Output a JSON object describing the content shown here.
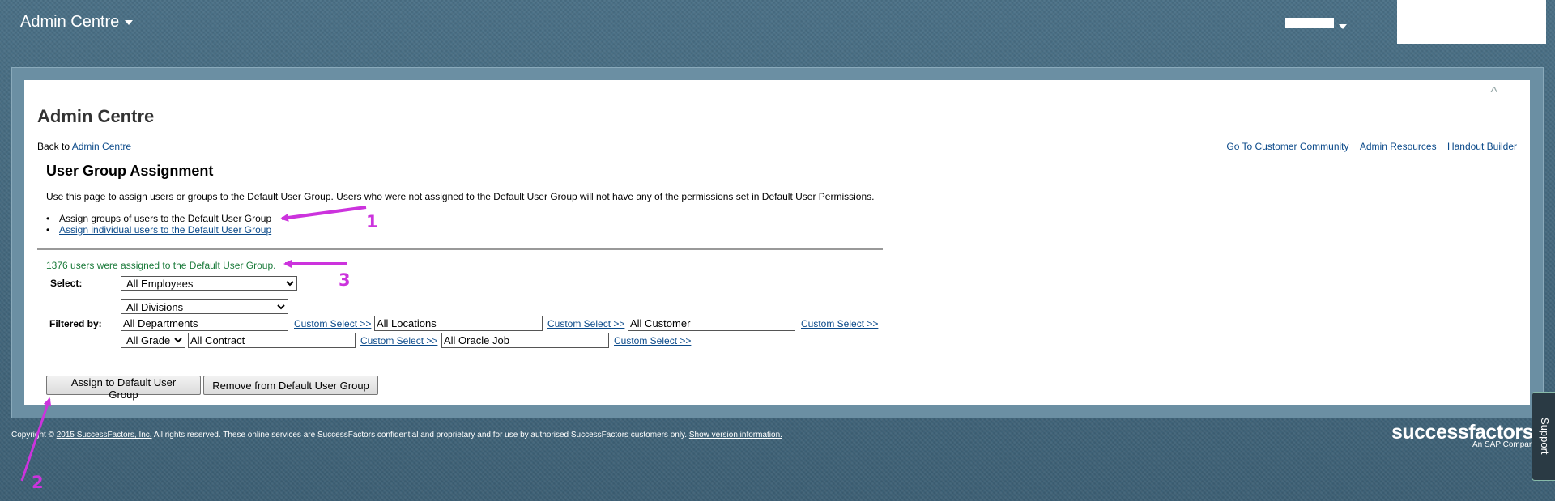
{
  "header": {
    "app_title": "Admin Centre"
  },
  "page": {
    "title": "Admin Centre",
    "back_prefix": "Back to",
    "back_link": "Admin Centre",
    "top_links": [
      "Go To Customer Community",
      "Admin Resources",
      "Handout Builder"
    ]
  },
  "section": {
    "title": "User Group Assignment",
    "description": "Use this page to assign users or groups to the Default User Group. Users who were not assigned to the Default User Group will not have any of the permissions set in Default User Permissions.",
    "bullet_groups": "Assign groups of users to the Default User Group",
    "bullet_individual": "Assign individual users to the Default User Group",
    "success_message": "1376 users were assigned to the Default User Group."
  },
  "filters": {
    "select_label": "Select:",
    "select_value": "All Employees",
    "filtered_by_label": "Filtered by:",
    "divisions": "All Divisions",
    "departments": "All Departments",
    "locations": "All Locations",
    "customer": "All Customer",
    "grade": "All Grade",
    "contract": "All Contract",
    "oracle_job": "All Oracle Job",
    "custom_select": "Custom Select >>"
  },
  "buttons": {
    "assign": "Assign to Default User Group",
    "remove": "Remove from Default User Group"
  },
  "footer": {
    "copyright_prefix": "Copyright ©",
    "company_link": "2015 SuccessFactors, Inc.",
    "notice": "All rights reserved. These online services are SuccessFactors confidential and proprietary and for use by authorised SuccessFactors customers only.",
    "version_link": "Show version information.",
    "logo": "successfactors",
    "logo_sub": "An SAP Company",
    "support_tab": "Support"
  },
  "annotations": [
    "1",
    "2",
    "3"
  ],
  "colors": {
    "annotation": "#cc33dd",
    "success": "#1a7a3a",
    "link": "#0b4a8a"
  }
}
